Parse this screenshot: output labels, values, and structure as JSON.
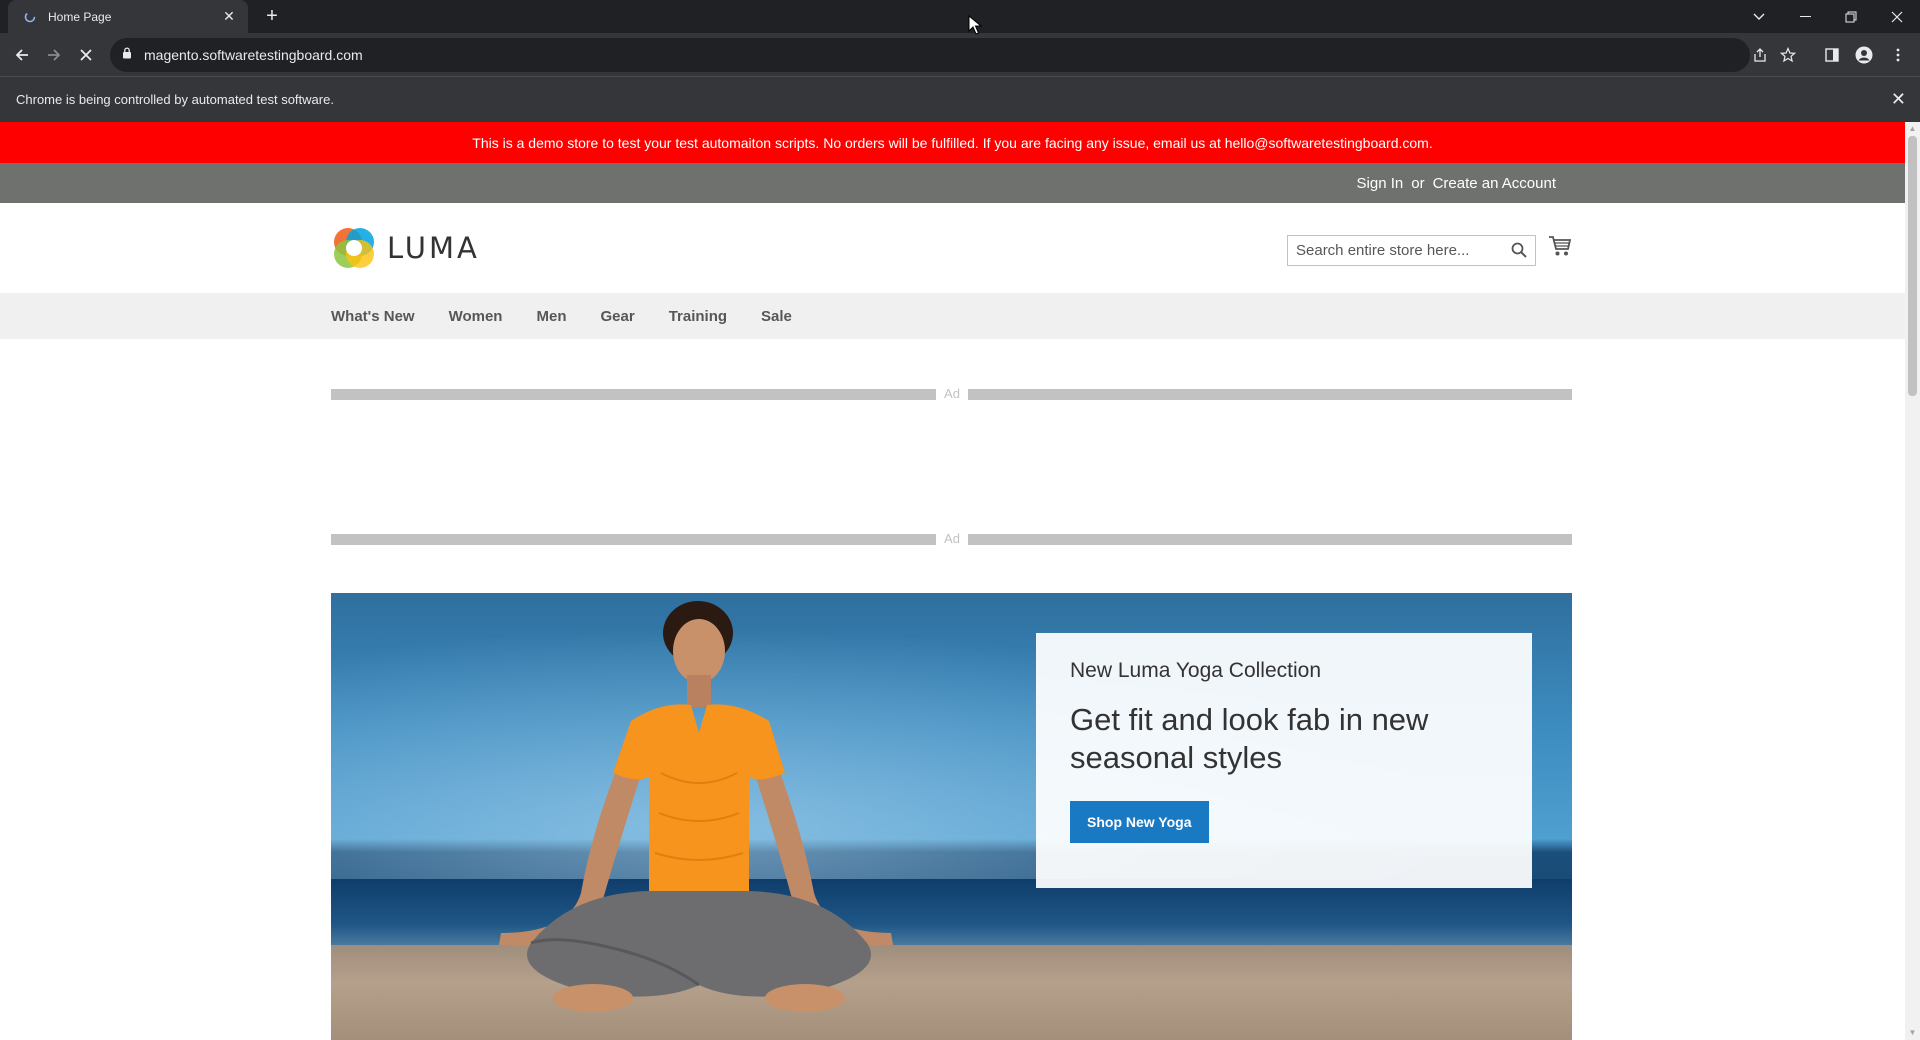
{
  "browser": {
    "tab_title": "Home Page",
    "url": "magento.softwaretestingboard.com",
    "infobar_text": "Chrome is being controlled by automated test software."
  },
  "site": {
    "demo_notice": "This is a demo store to test your test automaiton scripts. No orders will be fulfilled. If you are facing any issue, email us at hello@softwaretestingboard.com.",
    "header_links": {
      "sign_in": "Sign In",
      "or": "or",
      "create_account": "Create an Account"
    },
    "logo_text": "LUMA",
    "search_placeholder": "Search entire store here...",
    "nav": [
      "What's New",
      "Women",
      "Men",
      "Gear",
      "Training",
      "Sale"
    ],
    "ad_label": "Ad",
    "hero": {
      "subtitle": "New Luma Yoga Collection",
      "title": "Get fit and look fab in new seasonal styles",
      "button": "Shop New Yoga"
    }
  },
  "colors": {
    "demo_banner": "#ff0000",
    "panel_header": "#6e716e",
    "button_primary": "#1979c3"
  }
}
